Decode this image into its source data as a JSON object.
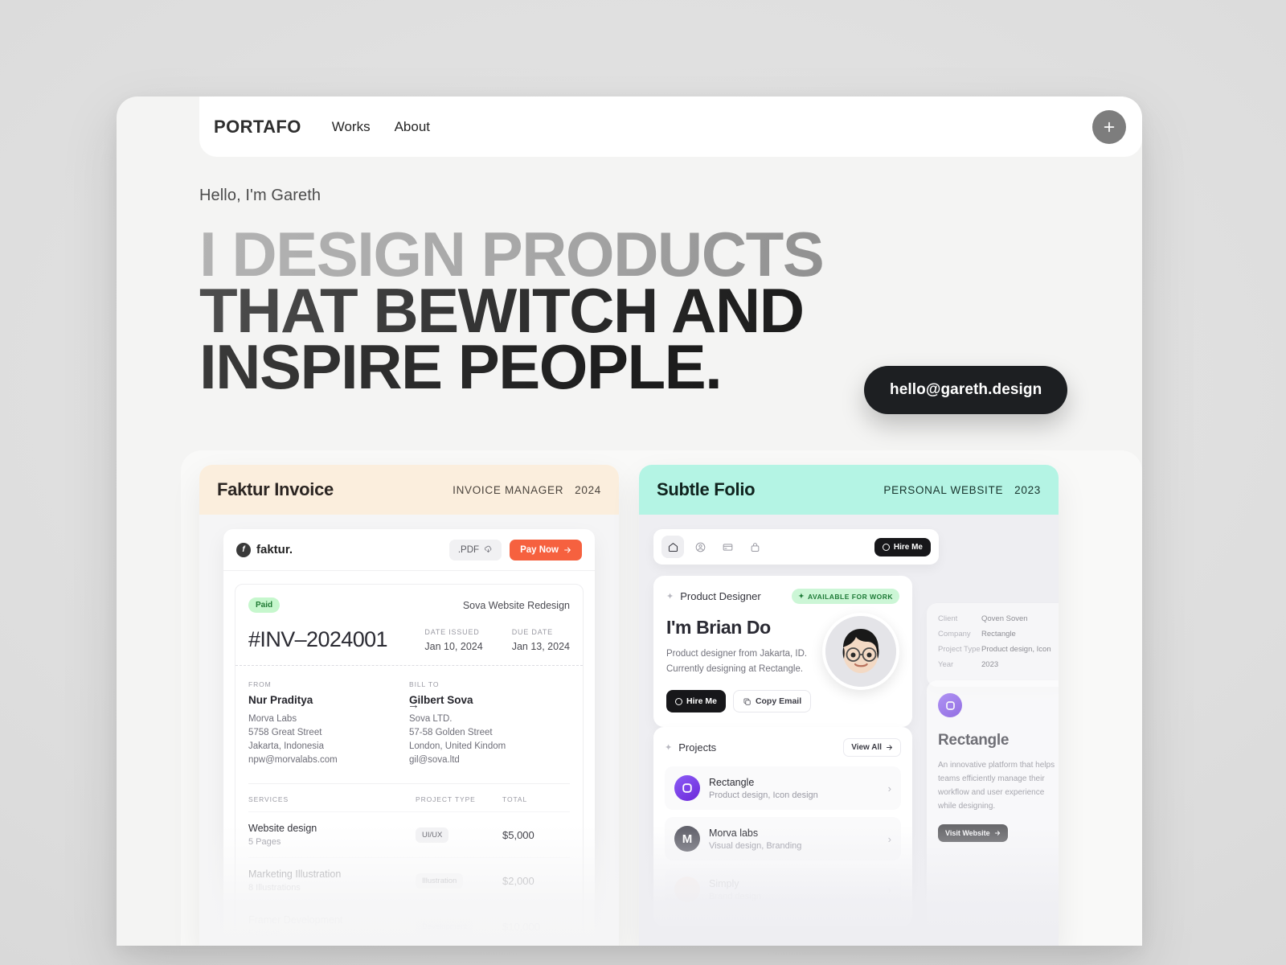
{
  "nav": {
    "logo": "PORTAFO",
    "links": [
      {
        "label": "Works"
      },
      {
        "label": "About"
      }
    ],
    "add_icon": "plus-icon"
  },
  "hero": {
    "greeting": "Hello, I'm Gareth",
    "headline_line1": "I DESIGN PRODUCTS",
    "headline_line2": "THAT BEWITCH AND",
    "headline_line3": "INSPIRE PEOPLE.",
    "email": "hello@gareth.design"
  },
  "works": [
    {
      "title": "Faktur Invoice",
      "category": "INVOICE MANAGER",
      "year": "2024",
      "accent": "#fbeedd"
    },
    {
      "title": "Subtle Folio",
      "category": "PERSONAL WEBSITE",
      "year": "2023",
      "accent": "#b4f4e4"
    }
  ],
  "faktur": {
    "brand_mark": "f",
    "brand": "faktur.",
    "pdf_label": ".PDF",
    "pdf_icon": "cloud-download-icon",
    "pay_label": "Pay Now",
    "pay_icon": "arrow-right-icon",
    "status": "Paid",
    "project": "Sova Website Redesign",
    "invoice_number": "#INV–2024001",
    "date_issued_label": "DATE ISSUED",
    "date_issued": "Jan 10, 2024",
    "due_date_label": "DUE DATE",
    "due_date": "Jan 13, 2024",
    "from_label": "FROM",
    "from": {
      "name": "Nur Praditya",
      "line1": "Morva Labs",
      "line2": "5758 Great Street",
      "line3": "Jakarta, Indonesia",
      "line4": "npw@morvalabs.com"
    },
    "bill_label": "BILL TO",
    "bill": {
      "name": "Gilbert Sova",
      "line1": "Sova LTD.",
      "line2": "57-58 Golden Street",
      "line3": "London, United Kindom",
      "line4": "gil@sova.ltd"
    },
    "table_headers": [
      "SERVICES",
      "PROJECT TYPE",
      "TOTAL"
    ],
    "rows": [
      {
        "name": "Website design",
        "sub": "5 Pages",
        "type": "UI/UX",
        "total": "$5,000"
      },
      {
        "name": "Marketing Illustration",
        "sub": "8 Illustrations",
        "type": "Illustration",
        "total": "$2,000"
      },
      {
        "name": "Framer Development",
        "sub": "5 pages",
        "type": "Development",
        "total": "$10,000"
      }
    ]
  },
  "folio": {
    "nav_icons": [
      "home-icon",
      "user-circle-icon",
      "credit-card-icon",
      "bag-icon"
    ],
    "hire_label": "Hire Me",
    "role": "Product Designer",
    "availability": "AVAILABLE FOR WORK",
    "name": "I'm Brian Do",
    "desc_line1": "Product designer from Jakarta, ID.",
    "desc_line2": "Currently designing at Rectangle.",
    "hire_btn": "Hire Me",
    "copy_btn": "Copy Email",
    "copy_icon": "copy-icon",
    "projects_title": "Projects",
    "view_all": "View All",
    "view_all_icon": "arrow-right-icon",
    "projects": [
      {
        "name": "Rectangle",
        "sub": "Product design, Icon design"
      },
      {
        "name": "Morva labs",
        "sub": "Visual design, Branding"
      },
      {
        "name": "Simply",
        "sub": "Brand design"
      }
    ],
    "detail": {
      "rows": [
        {
          "k": "Client",
          "v": "Qoven Soven"
        },
        {
          "k": "Company",
          "v": "Rectangle"
        },
        {
          "k": "Project Type",
          "v": "Product design, Icon"
        },
        {
          "k": "Year",
          "v": "2023"
        }
      ],
      "title": "Rectangle",
      "desc": "An innovative platform that helps teams efficiently manage their workflow and user experience while designing.",
      "cta": "Visit Website",
      "cta_icon": "arrow-right-icon"
    }
  }
}
